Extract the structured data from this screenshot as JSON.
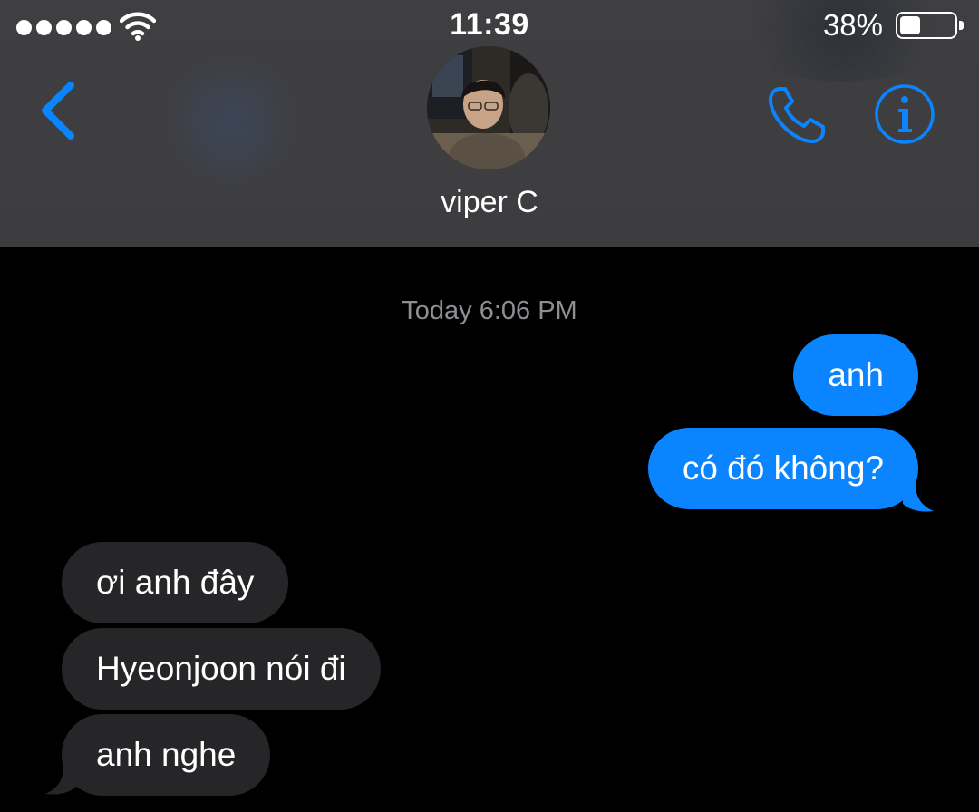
{
  "status_bar": {
    "time": "11:39",
    "battery_percent_label": "38%",
    "battery_level": 0.38,
    "signal_bars": 5
  },
  "header": {
    "contact_name": "viper C",
    "back_icon": "chevron-left-icon",
    "call_icon": "phone-icon",
    "info_icon": "info-icon",
    "accent_color": "#0a84ff"
  },
  "thread": {
    "timestamp": "Today 6:06 PM",
    "messages": [
      {
        "direction": "outgoing",
        "text": "anh"
      },
      {
        "direction": "outgoing",
        "text": "có đó không?"
      },
      {
        "direction": "incoming",
        "text": "ơi anh đây"
      },
      {
        "direction": "incoming",
        "text": "Hyeonjoon nói đi"
      },
      {
        "direction": "incoming",
        "text": "anh nghe"
      }
    ],
    "outgoing_color": "#0a84ff",
    "incoming_color": "#262628"
  }
}
